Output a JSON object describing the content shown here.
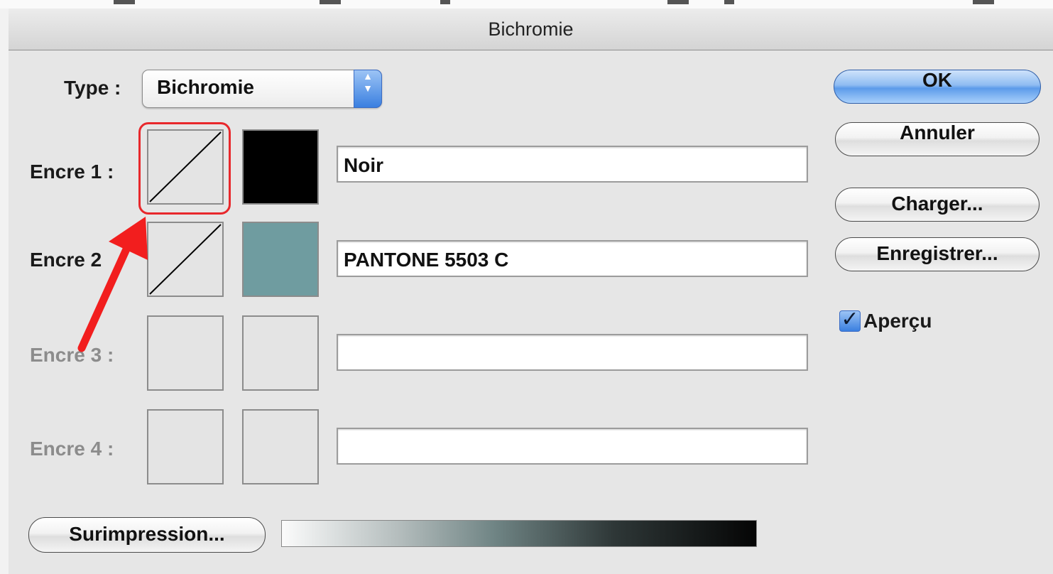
{
  "window": {
    "title": "Bichromie"
  },
  "type_row": {
    "label": "Type :",
    "selected": "Bichromie"
  },
  "inks": [
    {
      "label": "Encre 1 :",
      "name": "Noir",
      "color": "#000000"
    },
    {
      "label": "Encre 2",
      "name": "PANTONE 5503 C",
      "color": "#6f9ca0"
    },
    {
      "label": "Encre 3 :",
      "name": "",
      "color": ""
    },
    {
      "label": "Encre 4 :",
      "name": "",
      "color": ""
    }
  ],
  "buttons": {
    "ok": "OK",
    "cancel": "Annuler",
    "load": "Charger...",
    "save": "Enregistrer...",
    "overprint": "Surimpression..."
  },
  "preview": {
    "label": "Aperçu",
    "checked": true
  },
  "colors": {
    "highlight": "#e8282c",
    "accent": "#3a7fe0"
  },
  "icons": {
    "select_arrows": "up-down-arrows-icon",
    "checkmark": "checkmark-icon",
    "annotation": "red-arrow-icon"
  }
}
